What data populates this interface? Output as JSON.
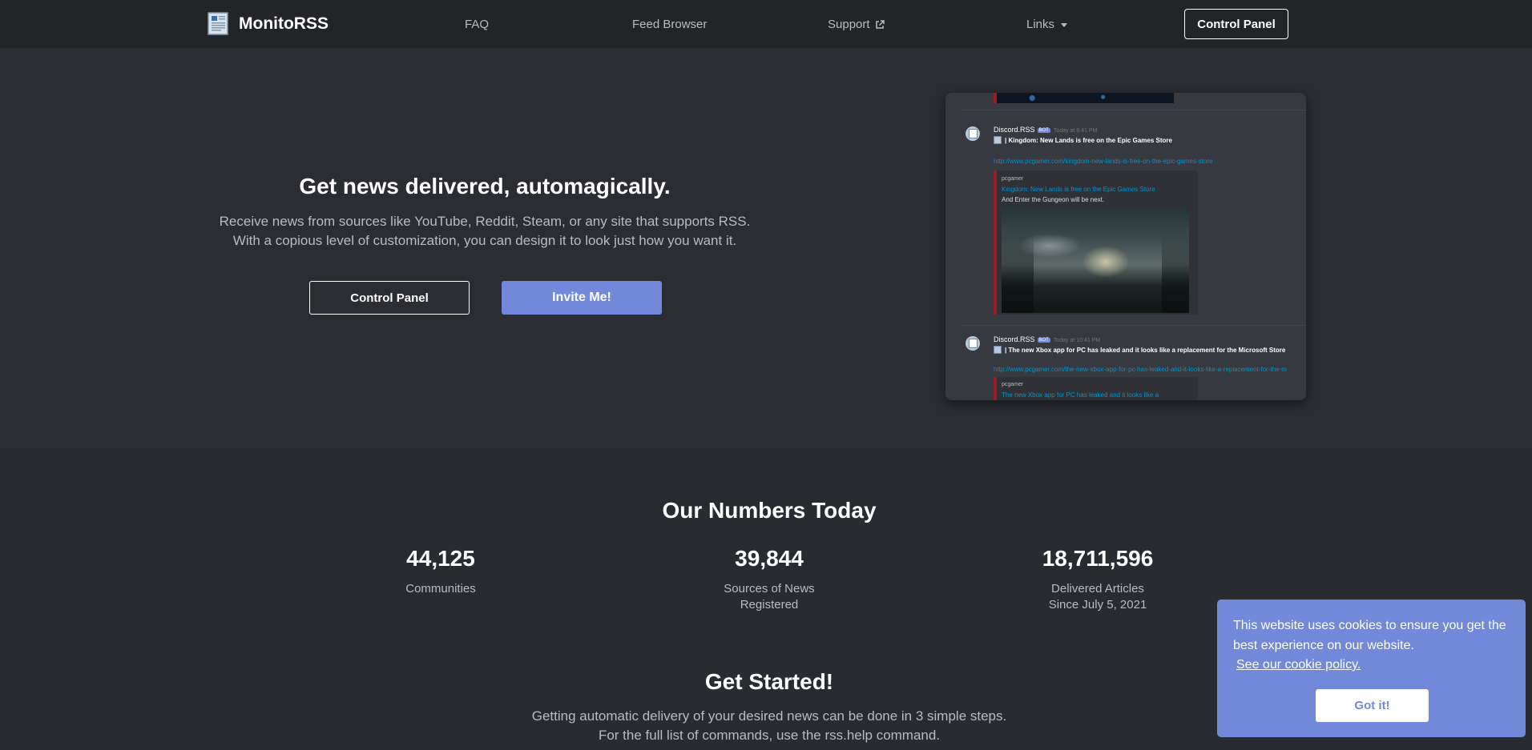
{
  "brand": {
    "name": "MonitoRSS",
    "logo_icon": "newspaper-icon"
  },
  "nav": {
    "faq": "FAQ",
    "feed_browser": "Feed Browser",
    "support": "Support",
    "links": "Links",
    "control_panel": "Control Panel"
  },
  "hero": {
    "title": "Get news delivered, automagically.",
    "desc_line1": "Receive news from sources like YouTube, Reddit, Steam, or any site that supports RSS.",
    "desc_line2": "With a copious level of customization, you can design it to look just how you want it.",
    "control_panel_button": "Control Panel",
    "invite_button": "Invite Me!"
  },
  "preview": {
    "messages": [
      {
        "author": "Discord.RSS",
        "bot_tag": "BOT",
        "time": "Today at 8:41 PM",
        "title": "Kingdom: New Lands is free on the Epic Games Store",
        "link": "http://www.pcgamer.com/kingdom-new-lands-is-free-on-the-epic-games-store",
        "embed_site": "pcgamer",
        "embed_title": "Kingdom: New Lands is free on the Epic Games Store",
        "embed_desc": "And Enter the Gungeon will be next."
      },
      {
        "author": "Discord.RSS",
        "bot_tag": "BOT",
        "time": "Today at 10:41 PM",
        "title": "The new Xbox app for PC has leaked and it looks like a replacement for the Microsoft Store",
        "link": "http://www.pcgamer.com/the-new-xbox-app-for-pc-has-leaked-and-it-looks-like-a-replacement-for-the-m",
        "embed_site": "pcgamer",
        "embed_title": "The new Xbox app for PC has leaked and it looks like a"
      }
    ]
  },
  "numbers": {
    "title": "Our Numbers Today",
    "stats": [
      {
        "value": "44,125",
        "label_line1": "Communities",
        "label_line2": ""
      },
      {
        "value": "39,844",
        "label_line1": "Sources of News",
        "label_line2": "Registered"
      },
      {
        "value": "18,711,596",
        "label_line1": "Delivered Articles",
        "label_line2": "Since July 5, 2021"
      }
    ]
  },
  "get_started": {
    "title": "Get Started!",
    "desc_line1": "Getting automatic delivery of your desired news can be done in 3 simple steps.",
    "desc_line2": "For the full list of commands, use the rss.help command."
  },
  "cookie": {
    "text": "This website uses cookies to ensure you get the best experience on our website.",
    "link": "See our cookie policy.",
    "button": "Got it!"
  },
  "colors": {
    "accent": "#7289da",
    "background": "#282b30",
    "navbar": "#222428",
    "embed_border": "#9b1c22",
    "link": "#0096cf"
  }
}
